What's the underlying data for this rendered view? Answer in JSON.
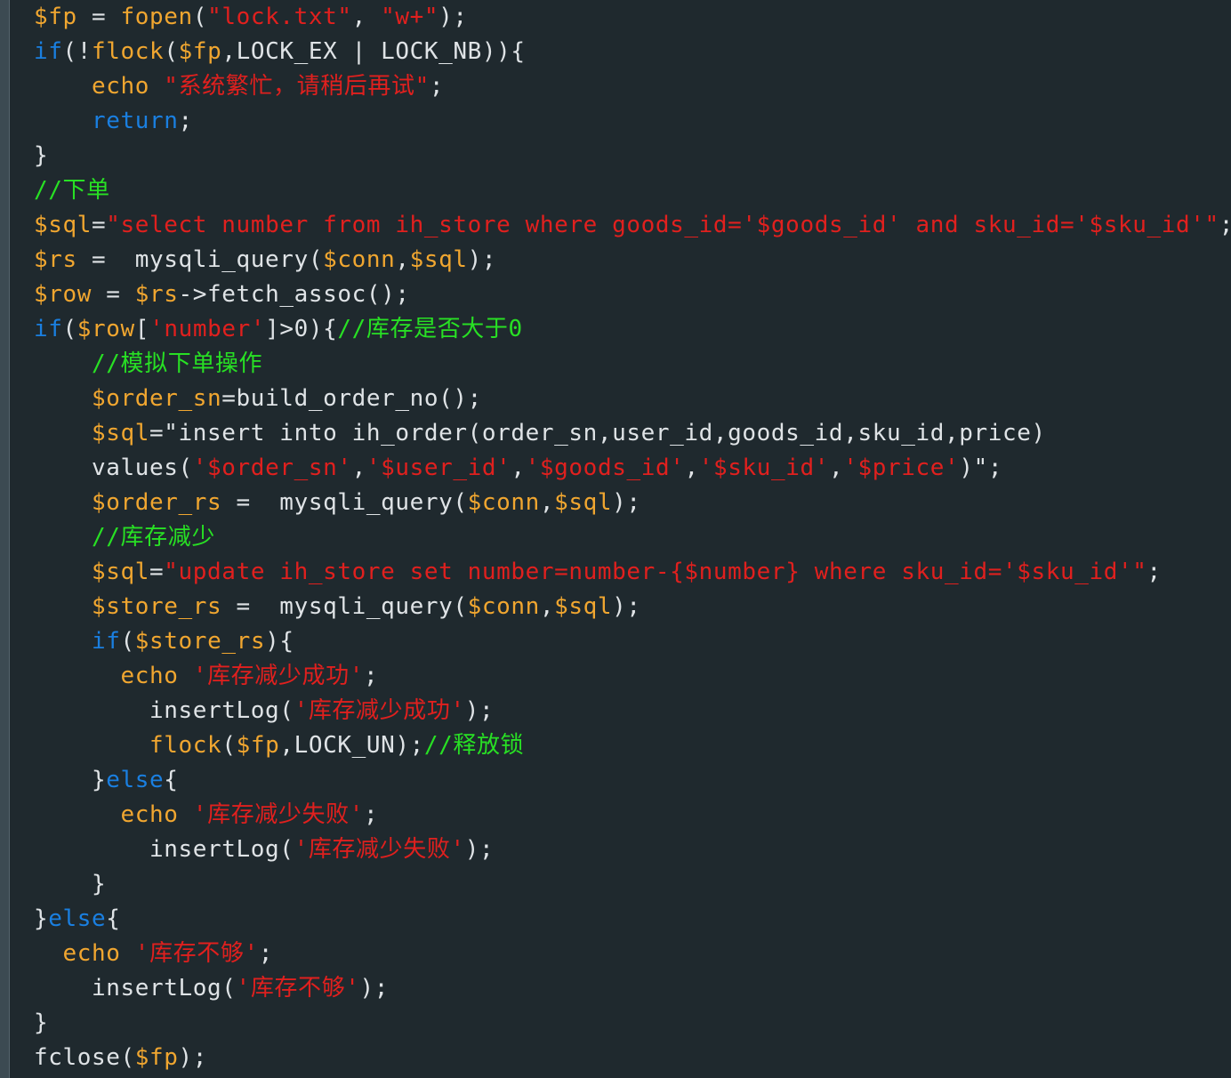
{
  "code_lines": [
    "$fp = fopen(\"lock.txt\", \"w+\");",
    "if(!flock($fp,LOCK_EX | LOCK_NB)){",
    "    echo \"系统繁忙，请稍后再试\";",
    "    return;",
    "}",
    "//下单",
    "$sql=\"select number from ih_store where goods_id='$goods_id' and sku_id='$sku_id'\";",
    "$rs =  mysqli_query($conn,$sql);",
    "$row = $rs->fetch_assoc();",
    "if($row['number']>0){//库存是否大于0",
    "    //模拟下单操作",
    "    $order_sn=build_order_no();",
    "    $sql=\"insert into ih_order(order_sn,user_id,goods_id,sku_id,price)",
    "    values('$order_sn','$user_id','$goods_id','$sku_id','$price')\";",
    "    $order_rs =  mysqli_query($conn,$sql);",
    "    //库存减少",
    "    $sql=\"update ih_store set number=number-{$number} where sku_id='$sku_id'\";",
    "    $store_rs =  mysqli_query($conn,$sql);",
    "    if($store_rs){",
    "      echo '库存减少成功';",
    "        insertLog('库存减少成功');",
    "        flock($fp,LOCK_UN);//释放锁",
    "    }else{",
    "      echo '库存减少失败';",
    "        insertLog('库存减少失败');",
    "    }",
    "}else{",
    "  echo '库存不够';",
    "    insertLog('库存不够');",
    "}",
    "fclose($fp);"
  ],
  "colors": {
    "background": "#1f292e",
    "keyword": "#1a7fe0",
    "string": "#e0201e",
    "variable": "#f0a630",
    "comment": "#28e024",
    "plain": "#dfe3e6"
  }
}
